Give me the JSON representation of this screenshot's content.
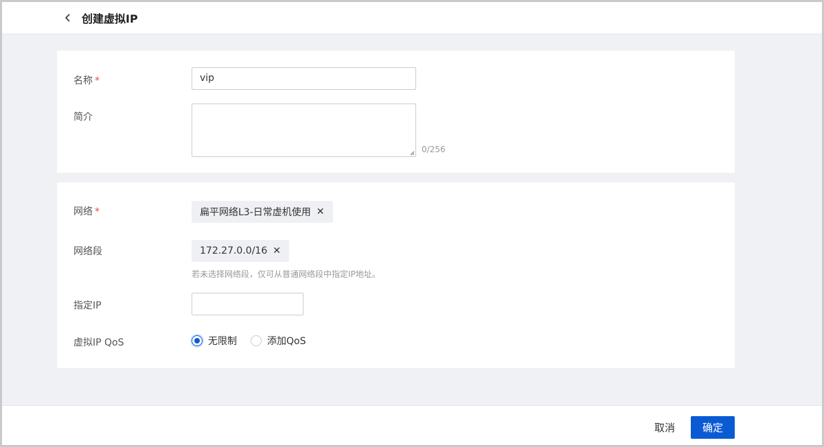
{
  "header": {
    "back_icon": "chevron-left-icon",
    "title": "创建虚拟IP"
  },
  "form": {
    "name": {
      "label": "名称",
      "required": "*",
      "value": "vip"
    },
    "description": {
      "label": "简介",
      "value": "",
      "counter": "0/256"
    },
    "network": {
      "label": "网络",
      "required": "*",
      "tag": "扁平网络L3-日常虚机使用",
      "tag_close": "✕"
    },
    "segment": {
      "label": "网络段",
      "tag": "172.27.0.0/16",
      "tag_close": "✕",
      "hint": "若未选择网络段，仅可从普通网络段中指定IP地址。"
    },
    "ip": {
      "label": "指定IP",
      "value": ""
    },
    "qos": {
      "label": "虚拟IP QoS",
      "options": [
        {
          "label": "无限制",
          "checked": true
        },
        {
          "label": "添加QoS",
          "checked": false
        }
      ]
    }
  },
  "footer": {
    "cancel_label": "取消",
    "ok_label": "确定"
  },
  "colors": {
    "primary": "#0a5bd3",
    "required": "#e5484d",
    "background": "#f0f1f4"
  }
}
